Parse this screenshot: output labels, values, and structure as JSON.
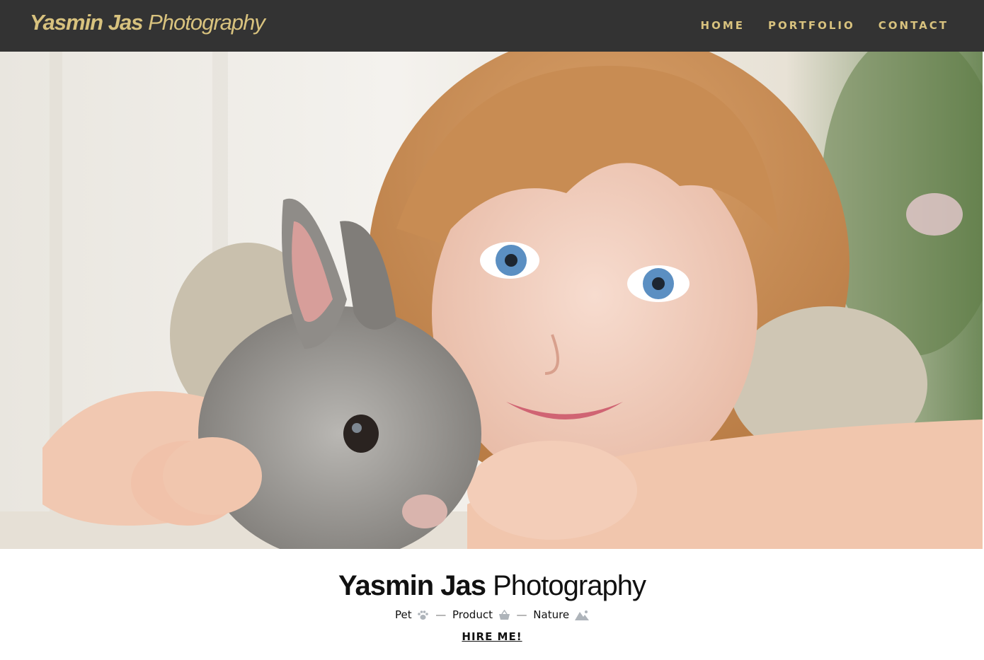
{
  "header": {
    "brand_bold": "Yasmin Jas",
    "brand_light": "Photography",
    "nav": [
      {
        "label": "HOME"
      },
      {
        "label": "PORTFOLIO"
      },
      {
        "label": "CONTACT"
      }
    ]
  },
  "hero": {
    "image_icon": "child-with-bunny-photo"
  },
  "intro": {
    "title_bold": "Yasmin Jas",
    "title_light": "Photography",
    "tags": [
      {
        "label": "Pet",
        "icon": "paw-icon"
      },
      {
        "label": "Product",
        "icon": "basket-icon"
      },
      {
        "label": "Nature",
        "icon": "mountain-icon"
      }
    ],
    "separator": "—",
    "hire_label": "HIRE ME!"
  },
  "colors": {
    "navbar_bg": "#333333",
    "accent_gold": "#d8c27e",
    "text_dark": "#111111"
  }
}
